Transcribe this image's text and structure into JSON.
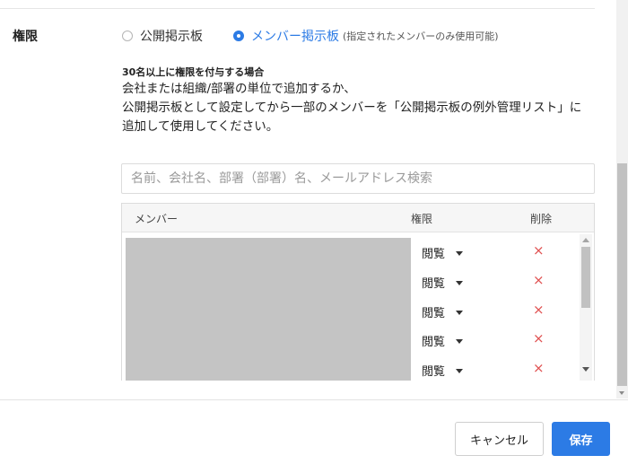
{
  "permission": {
    "label": "権限",
    "options": [
      {
        "label": "公開掲示板",
        "checked": false
      },
      {
        "label": "メンバー掲示板",
        "note": "(指定されたメンバーのみ使用可能)",
        "checked": true
      }
    ]
  },
  "notice": {
    "heading": "30名以上に権限を付与する場合",
    "lines": [
      "会社または組織/部署の単位で追加するか、",
      "公開掲示板として設定してから一部のメンバーを「公開掲示板の例外管理リスト」に追加して使用してください。"
    ]
  },
  "search": {
    "placeholder": "名前、会社名、部署（部署）名、メールアドレス検索",
    "value": ""
  },
  "table": {
    "columns": [
      "メンバー",
      "権限",
      "削除"
    ],
    "rows": [
      {
        "permission": "閲覧",
        "delete": "×"
      },
      {
        "permission": "閲覧",
        "delete": "×"
      },
      {
        "permission": "閲覧",
        "delete": "×"
      },
      {
        "permission": "閲覧",
        "delete": "×"
      },
      {
        "permission": "閲覧",
        "delete": "×"
      }
    ]
  },
  "footer": {
    "cancel_label": "キャンセル",
    "save_label": "保存"
  },
  "colors": {
    "accent": "#2c7be5",
    "delete": "#e05050",
    "redacted": "#c4c4c4"
  }
}
